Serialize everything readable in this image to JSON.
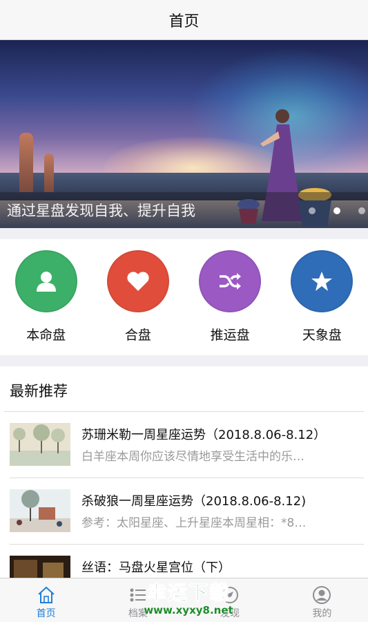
{
  "navbar": {
    "title": "首页"
  },
  "banner": {
    "caption": "通过星盘发现自我、提升自我",
    "slide_count": 3,
    "active_slide": 2
  },
  "features": [
    {
      "label": "本命盘",
      "icon": "user-icon",
      "color": "#3cb068"
    },
    {
      "label": "合盘",
      "icon": "heart-icon",
      "color": "#e04e3b"
    },
    {
      "label": "推运盘",
      "icon": "shuffle-icon",
      "color": "#9b59c4"
    },
    {
      "label": "天象盘",
      "icon": "star-icon",
      "color": "#2f6db8"
    }
  ],
  "recommend": {
    "title": "最新推荐",
    "articles": [
      {
        "title": "苏珊米勒一周星座运势（2018.8.06-8.12）",
        "desc": "白羊座本周你应该尽情地享受生活中的乐…"
      },
      {
        "title": "杀破狼一周星座运势（2018.8.06-8.12)",
        "desc": "参考：太阳星座、上升星座本周星相：*8…"
      },
      {
        "title": "丝语：马盘火星宫位（下）",
        "desc": ""
      }
    ]
  },
  "tabbar": {
    "items": [
      {
        "label": "首页",
        "icon": "home-icon",
        "active": true
      },
      {
        "label": "档案",
        "icon": "list-icon",
        "active": false
      },
      {
        "label": "发现",
        "icon": "compass-icon",
        "active": false
      },
      {
        "label": "我的",
        "icon": "profile-icon",
        "active": false
      }
    ]
  },
  "watermark": {
    "main": "幸运下载",
    "url": "www.xyxy8.net"
  },
  "colors": {
    "tab_active": "#1e7fd6",
    "tab_inactive": "#8e8e93"
  }
}
